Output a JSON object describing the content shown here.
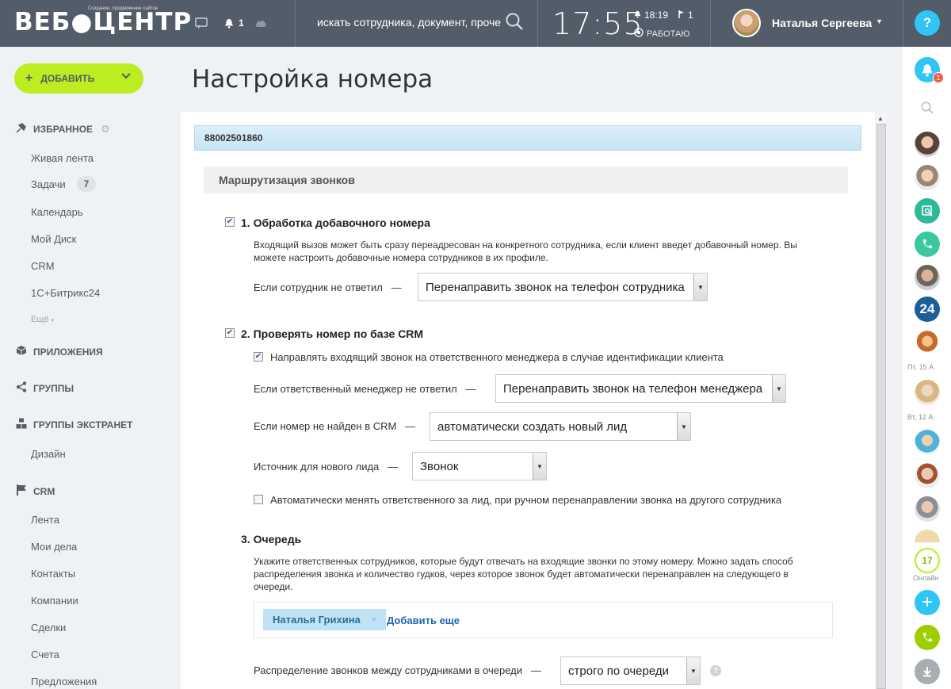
{
  "header": {
    "logo_main": "ВЕБ●ЦЕНТР",
    "logo_sub": "Создание, продвижение сайтов",
    "notifications_count": "1",
    "search_placeholder": "искать сотрудника, документ, проче",
    "clock": "17:55",
    "alarm_time": "18:19",
    "flag_count": "1",
    "work_status": "РАБОТАЮ",
    "user_name": "Наталья Сергеева",
    "help_label": "?"
  },
  "sidebar": {
    "add_button": "ДОБАВИТЬ",
    "favorites_title": "ИЗБРАННОЕ",
    "favorites": [
      {
        "label": "Живая лента"
      },
      {
        "label": "Задачи",
        "badge": "7"
      },
      {
        "label": "Календарь"
      },
      {
        "label": "Мой Диск"
      },
      {
        "label": "CRM"
      },
      {
        "label": "1С+Битрикс24"
      }
    ],
    "more_label": "Ещё",
    "apps_title": "ПРИЛОЖЕНИЯ",
    "groups_title": "ГРУППЫ",
    "extranet_title": "ГРУППЫ ЭКСТРАНЕТ",
    "extranet_items": [
      {
        "label": "Дизайн"
      }
    ],
    "crm_title": "CRM",
    "crm_items": [
      {
        "label": "Лента"
      },
      {
        "label": "Мои дела"
      },
      {
        "label": "Контакты"
      },
      {
        "label": "Компании"
      },
      {
        "label": "Сделки"
      },
      {
        "label": "Счета"
      },
      {
        "label": "Предложения"
      }
    ]
  },
  "main": {
    "page_title": "Настройка номера",
    "phone_number": "88002501860",
    "routing_title": "Маршрутизация звонков",
    "section1": {
      "title": "1. Обработка добавочного номера",
      "checked": true,
      "description": "Входящий вызов может быть сразу переадресован на конкретного сотрудника, если клиент введет добавочный номер. Вы можете настроить добавочные номера сотрудников в их профиле.",
      "no_answer_label": "Если сотрудник не ответил",
      "no_answer_value": "Перенаправить звонок на телефон сотрудника"
    },
    "section2": {
      "title": "2. Проверять номер по базе CRM",
      "checked": true,
      "redirect_manager_label": "Направлять входящий звонок на ответственного менеджера в случае идентификации клиента",
      "redirect_manager_checked": true,
      "manager_no_answer_label": "Если ответственный менеджер не ответил",
      "manager_no_answer_value": "Перенаправить звонок на телефон менеджера",
      "not_found_label": "Если номер не найден в CRM",
      "not_found_value": "автоматически создать новый лид",
      "source_label": "Источник для нового лида",
      "source_value": "Звонок",
      "auto_change_label": "Автоматически менять ответственного за лид, при ручном перенаправлении звонка на другого сотрудника",
      "auto_change_checked": false
    },
    "section3": {
      "title": "3. Очередь",
      "description": "Укажите ответственных сотрудников, которые будут отвечать на входящие звонки по этому номеру. Можно задать способ распределения звонка и количество гудков, через которое звонок будет автоматически перенаправлен на следующего в очереди.",
      "queue_member": "Наталья Грихина",
      "remove_label": "×",
      "add_more": "Добавить еще",
      "distribution_label": "Распределение звонков между сотрудниками в очереди",
      "distribution_value": "строго по очереди"
    },
    "dash": "—"
  },
  "rightbar": {
    "notif_badge": "1",
    "date1": "Пт, 15 А",
    "date2": "Вт, 12 А",
    "online_count": "17",
    "online_label": "Онлайн",
    "b24_label": "24"
  },
  "colors": {
    "header_bg": "#535c69",
    "add_button": "#bbed21",
    "accent_blue": "#2fc6f6",
    "phone_green": "#9dcf00",
    "notif_red": "#f05a4a"
  }
}
